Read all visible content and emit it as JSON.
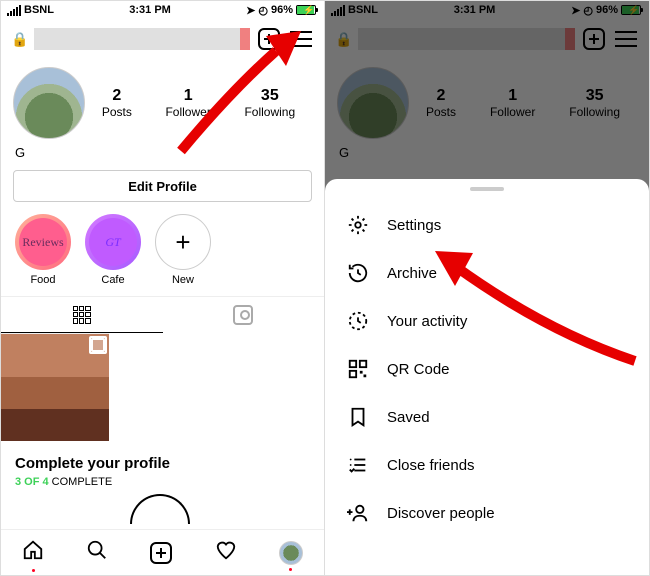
{
  "status": {
    "carrier": "BSNL",
    "time": "3:31 PM",
    "battery_pct": "96%"
  },
  "profile": {
    "name": "G",
    "posts": {
      "n": "2",
      "l": "Posts"
    },
    "followers": {
      "n": "1",
      "l": "Follower"
    },
    "following": {
      "n": "35",
      "l": "Following"
    },
    "edit": "Edit Profile"
  },
  "highlights": [
    {
      "label": "Food",
      "inner": "Reviews"
    },
    {
      "label": "Cafe",
      "inner": "GT"
    },
    {
      "label": "New"
    }
  ],
  "complete": {
    "title": "Complete your profile",
    "done": "3 OF 4",
    "suffix": " COMPLETE"
  },
  "menu": {
    "settings": "Settings",
    "archive": "Archive",
    "activity": "Your activity",
    "qr": "QR Code",
    "saved": "Saved",
    "close": "Close friends",
    "discover": "Discover people"
  }
}
